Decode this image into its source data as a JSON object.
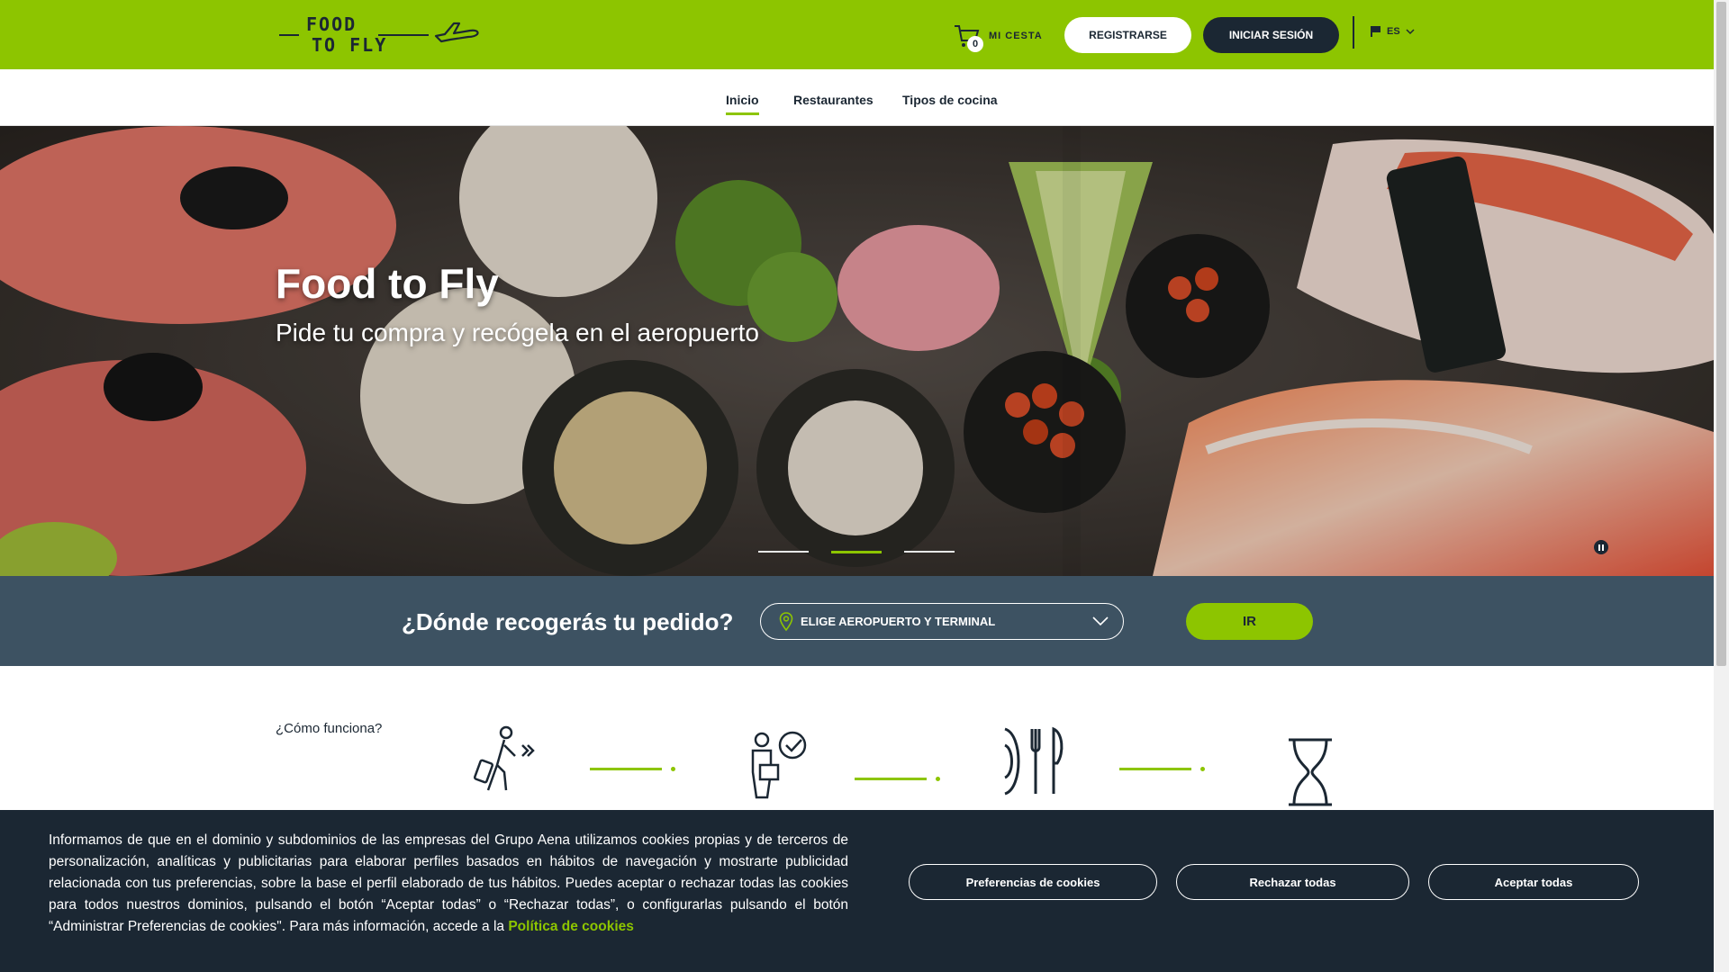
{
  "header": {
    "logo_line1": "FOOD",
    "logo_line2": "TO FLY",
    "cart_count": "0",
    "cart_label": "MI CESTA",
    "register_label": "REGISTRARSE",
    "login_label": "INICIAR SESIÓN",
    "language": "ES"
  },
  "nav": {
    "items": [
      {
        "label": "Inicio",
        "active": true
      },
      {
        "label": "Restaurantes",
        "active": false
      },
      {
        "label": "Tipos de cocina",
        "active": false
      }
    ]
  },
  "hero": {
    "title": "Food to Fly",
    "subtitle": "Pide tu compra y recógela en el aeropuerto",
    "slides": 3,
    "active_slide": 2
  },
  "search": {
    "question": "¿Dónde recogerás tu pedido?",
    "select_placeholder": "ELIGE AEROPUERTO Y TERMINAL",
    "go_label": "IR"
  },
  "how": {
    "label": "¿Cómo funciona?",
    "steps": [
      "walking-traveler-icon",
      "person-check-icon",
      "plate-cutlery-icon",
      "hourglass-icon"
    ]
  },
  "cookies": {
    "text": "Informamos de que en el dominio y subdominios de las empresas del Grupo Aena utilizamos cookies propias y de terceros de personalización, analíticas y publicitarias para elaborar perfiles basados en hábitos de navegación y mostrarte publicidad relacionada con tus preferencias, sobre la base el perfil elaborado de tus hábitos. Puedes aceptar o rechazar todas las cookies para todos nuestros dominios, pulsando el botón “Aceptar todas” o “Rechazar todas”, o configurarlas pulsando el botón “Administrar Preferencias de cookies\". Para más información, accede a la",
    "link": "Política de cookies",
    "preferences_label": "Preferencias de cookies",
    "reject_label": "Rechazar todas",
    "accept_label": "Aceptar todas"
  },
  "colors": {
    "brand_green": "#8dc500",
    "navy": "#1b2733",
    "band": "#3d5262"
  }
}
